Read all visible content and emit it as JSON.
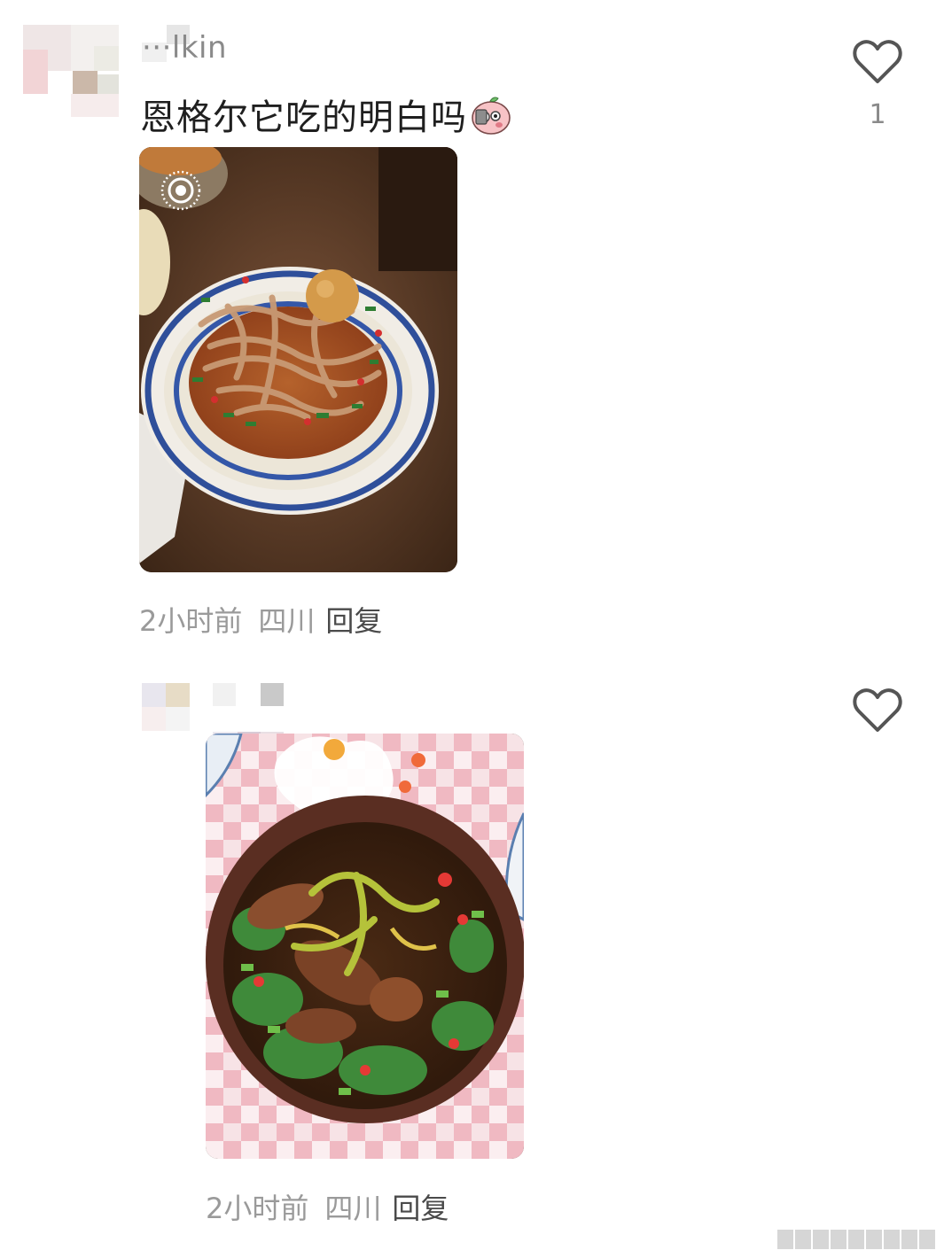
{
  "comments": [
    {
      "username": "···lkin",
      "text": "恩格尔它吃的明白吗",
      "sticker_icon": "pig-sticker-icon",
      "like_count": "1",
      "photo_badge_icon": "live-photo-icon",
      "meta": {
        "time": "2小时前",
        "location": "四川",
        "reply": "回复"
      }
    },
    {
      "username": "",
      "text": "",
      "like_count": "",
      "meta": {
        "time": "2小时前",
        "location": "四川",
        "reply": "回复"
      }
    }
  ],
  "colors": {
    "meta_text": "#9a9a9a",
    "reply_text": "#4a4a4a",
    "comment_text": "#1f1f1f",
    "icon_stroke": "#555555"
  }
}
